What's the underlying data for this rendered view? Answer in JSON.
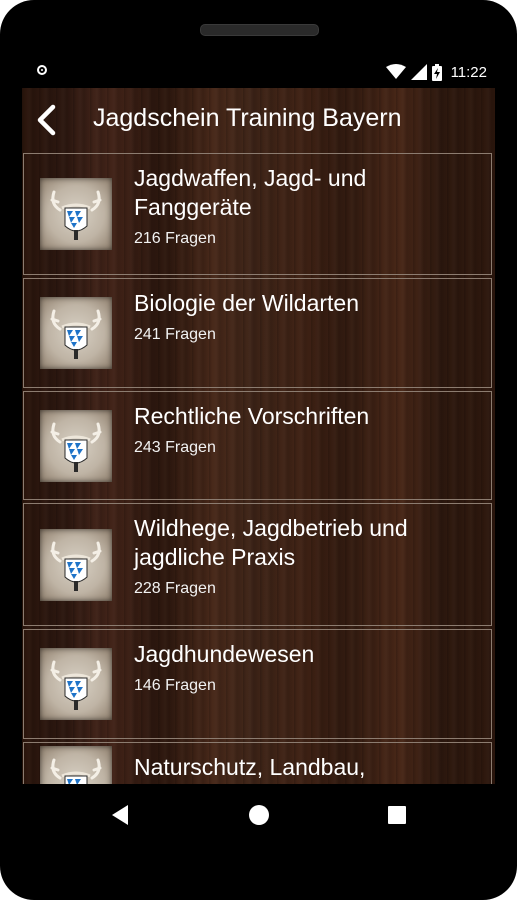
{
  "status": {
    "time": "11:22",
    "icons": [
      "circle-notification-icon",
      "wifi-icon",
      "signal-icon",
      "battery-charging-icon"
    ]
  },
  "appbar": {
    "back_icon": "chevron-left-icon",
    "title": "Jagdschein Training Bayern"
  },
  "categories": [
    {
      "title": "Jagdwaffen, Jagd- und Fanggeräte",
      "count": "216 Fragen"
    },
    {
      "title": "Biologie der Wildarten",
      "count": "241 Fragen"
    },
    {
      "title": "Rechtliche Vorschriften",
      "count": "243 Fragen"
    },
    {
      "title": "Wildhege, Jagdbetrieb und jagdliche Praxis",
      "count": "228 Fragen"
    },
    {
      "title": "Jagdhundewesen",
      "count": "146 Fragen"
    },
    {
      "title": "Naturschutz, Landbau,",
      "count": ""
    }
  ],
  "navbar": {
    "icons": [
      "back-triangle-icon",
      "home-circle-icon",
      "recents-square-icon"
    ]
  },
  "colors": {
    "phone_body": "#000000",
    "wood_dark": "#2a150c",
    "wood_mid": "#45251a",
    "card_border": "#8c7c70",
    "bavaria_blue": "#1e73c8",
    "text": "#ffffff"
  }
}
